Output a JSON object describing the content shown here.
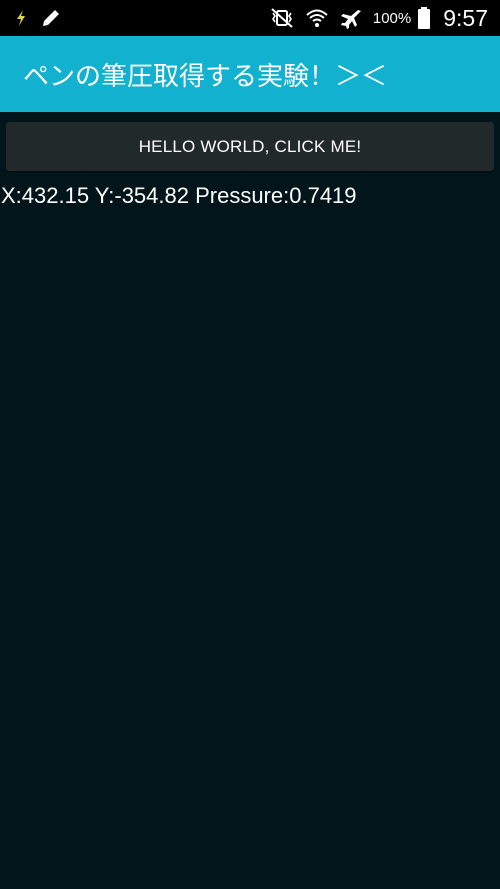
{
  "status_bar": {
    "battery_percent": "100%",
    "time": "9:57",
    "icons": [
      "charging-bolt-icon",
      "pencil-icon",
      "vibrate-mute-icon",
      "wifi-icon",
      "airplane-mode-icon",
      "battery-icon"
    ]
  },
  "app_bar": {
    "title": "ペンの筆圧取得する実験！＞＜",
    "color": "#13b1d0"
  },
  "main": {
    "button_label": "HELLO WORLD, CLICK ME!",
    "readout": "X:432.15 Y:-354.82 Pressure:0.7419",
    "background": "#01151b"
  }
}
